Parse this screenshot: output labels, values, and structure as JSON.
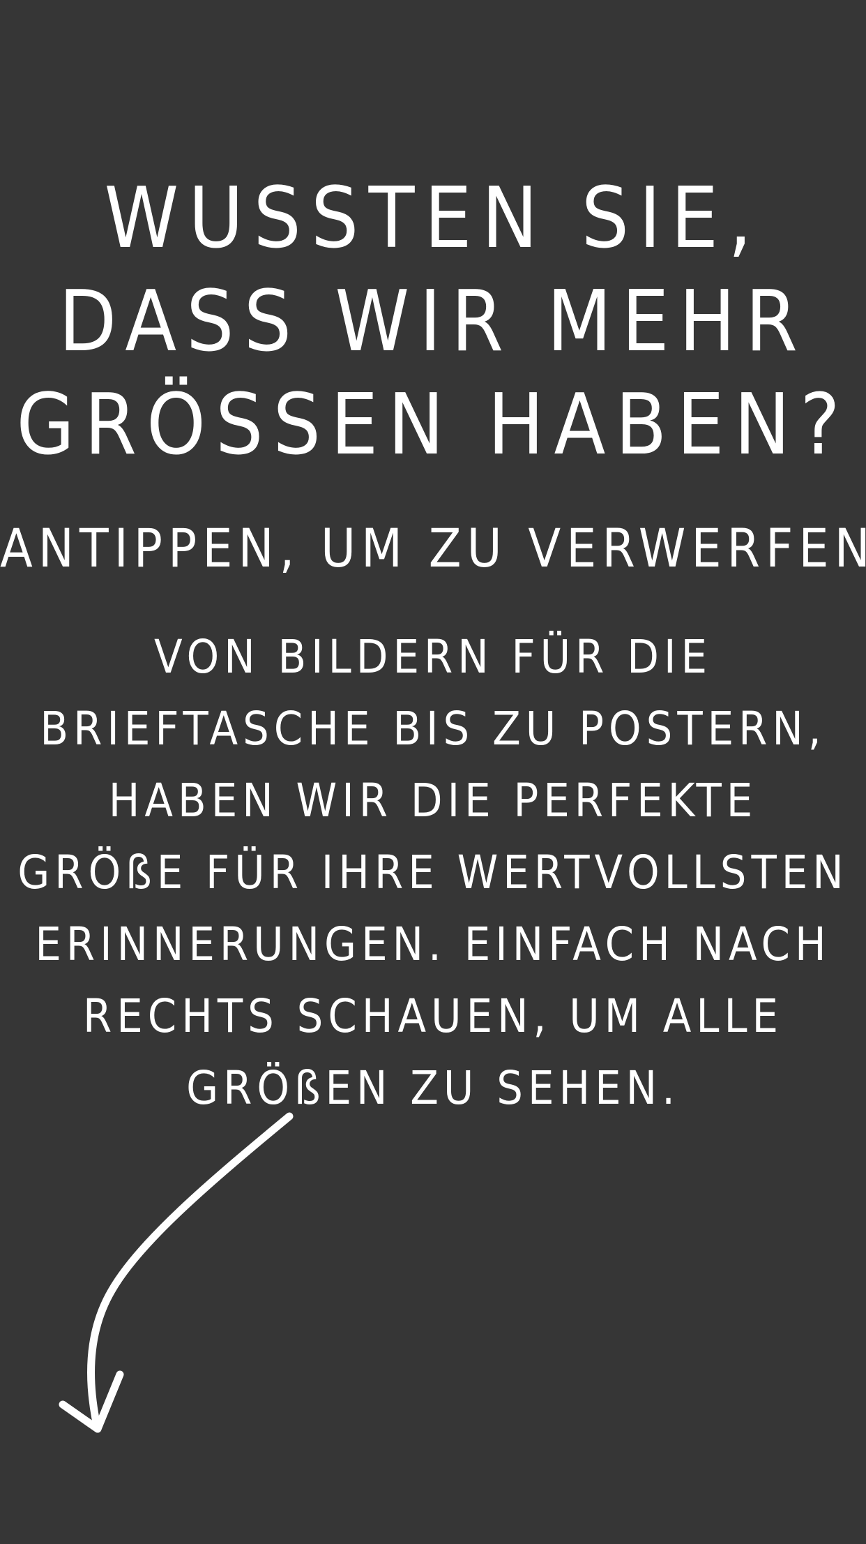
{
  "headline": {
    "lines": [
      "WUSSTEN SIE,",
      "DASS WIR MEHR",
      "GRÖßEN HABEN?"
    ]
  },
  "dismiss_hint": "ANTIPPEN, UM ZU VERWERFEN",
  "body": {
    "lines": [
      "VON BILDERN FÜR DIE",
      "BRIEFTASCHE BIS ZU POSTERN,",
      "HABEN WIR DIE PERFEKTE",
      "GRÖßE FÜR IHRE WERTVOLLSTEN",
      "ERINNERUNGEN. EINFACH NACH",
      "RECHTS SCHAUEN, UM ALLE",
      "GRÖßEN ZU SEHEN."
    ]
  },
  "icons": {
    "arrow": "curved-arrow-down-left"
  },
  "colors": {
    "background": "#363636",
    "text": "#ffffff"
  }
}
